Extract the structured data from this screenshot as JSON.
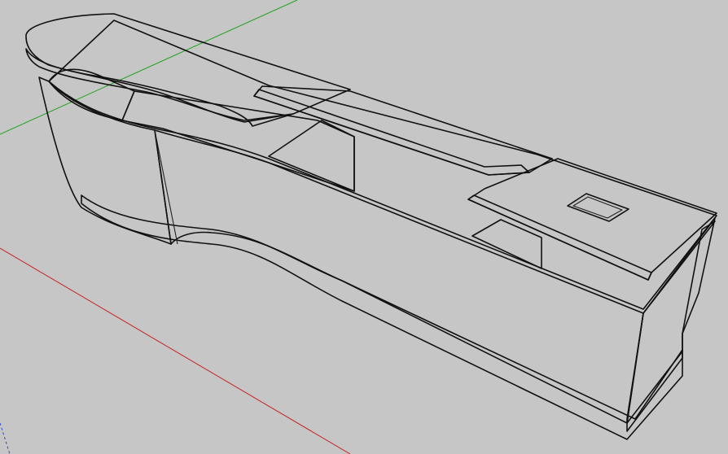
{
  "window": {
    "app_title": ""
  },
  "viewport": {
    "background_color": "#c6c6c6",
    "view_mode": "perspective",
    "axis_colors": {
      "red_axis": "#cc2222",
      "green_axis": "#22aa22",
      "blue_axis": "#2244cc"
    }
  },
  "model": {
    "description_visible_text": "",
    "face_colors": {
      "front_light": "#f6f6f6",
      "top_light": "#eeeeee",
      "side_mid": "#dcdcdc",
      "shadow": "#bdbdbd",
      "edge": "#111111"
    },
    "parts": [
      {
        "name": "counter-body",
        "icon": "box-shape"
      },
      {
        "name": "curved-end-top",
        "icon": "rounded-slab"
      },
      {
        "name": "middle-shelf-top",
        "icon": "slab"
      },
      {
        "name": "right-top-with-slot",
        "icon": "slab-with-hole"
      },
      {
        "name": "cable-slot",
        "icon": "rectangle-hole"
      },
      {
        "name": "base-plinth",
        "icon": "plinth"
      }
    ]
  }
}
